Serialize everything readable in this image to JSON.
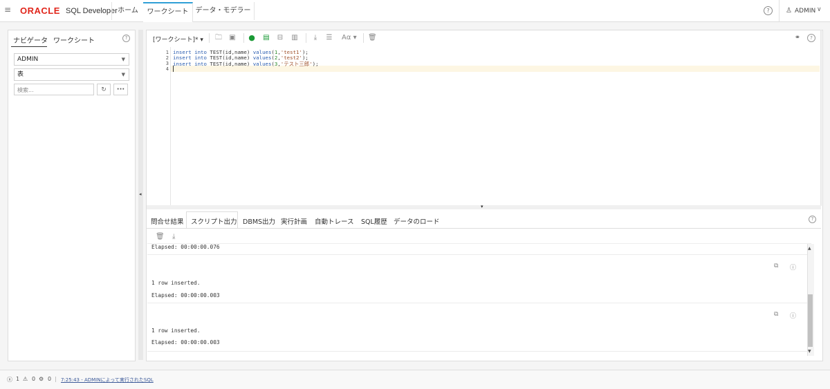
{
  "topbar": {
    "logo_text": "ORACLE",
    "app_name": "SQL Developer",
    "tabs": [
      {
        "label": "ホーム"
      },
      {
        "label": "ワークシート"
      },
      {
        "label": "データ・モデラー"
      }
    ],
    "active_tab": "ワークシート",
    "help_icon": "help-circle-icon",
    "user_name": "ADMIN"
  },
  "navigator": {
    "tabs": [
      {
        "label": "ナビゲータ"
      },
      {
        "label": "ワークシート"
      }
    ],
    "schema_value": "ADMIN",
    "object_type_value": "表",
    "search_placeholder": "検索..."
  },
  "worksheet": {
    "name_label": "[ワークシート]*",
    "lines": [
      {
        "num": "1",
        "text": "insert into TEST(id,name) values(1,'test1');"
      },
      {
        "num": "2",
        "text": "insert into TEST(id,name) values(2,'test2');"
      },
      {
        "num": "3",
        "text": "insert into TEST(id,name) values(3,'テスト三郎');"
      },
      {
        "num": "4",
        "text": ""
      }
    ],
    "format_label": "Aα"
  },
  "output": {
    "tabs": [
      {
        "label": "問合せ結果"
      },
      {
        "label": "スクリプト出力"
      },
      {
        "label": "DBMS出力"
      },
      {
        "label": "実行計画"
      },
      {
        "label": "自動トレース"
      },
      {
        "label": "SQL履歴"
      },
      {
        "label": "データのロード"
      }
    ],
    "active_tab": "スクリプト出力",
    "entries": [
      {
        "text": "Elapsed: 00:00:00.076"
      },
      {
        "text": "1 row inserted."
      },
      {
        "text": "Elapsed: 00:00:00.003"
      },
      {
        "text": "1 row inserted."
      },
      {
        "text": "Elapsed: 00:00:00.003"
      }
    ]
  },
  "statusbar": {
    "errors": "1",
    "warnings": "0",
    "info": "0",
    "message": "7:25:43 - ADMINによって実行されたSQL"
  },
  "colors": {
    "oracle_red": "#e1251b",
    "accent_blue": "#2f9fd6",
    "run_green": "#1a9a35"
  }
}
